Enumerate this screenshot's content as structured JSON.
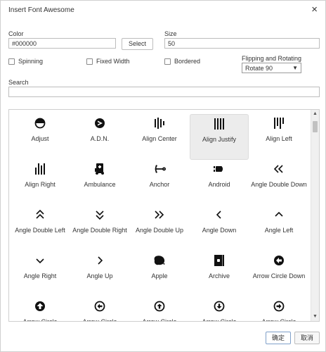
{
  "dialog": {
    "title": "Insert Font Awesome",
    "close_glyph": "×"
  },
  "color": {
    "label": "Color",
    "value": "#000000",
    "select_label": "Select"
  },
  "size": {
    "label": "Size",
    "value": "50"
  },
  "options": {
    "spinning": "Spinning",
    "fixed_width": "Fixed Width",
    "bordered": "Bordered"
  },
  "flipping": {
    "label": "Flipping and Rotating",
    "value": "Rotate 90"
  },
  "search": {
    "label": "Search",
    "value": ""
  },
  "icons": [
    {
      "name": "Adjust",
      "icon": "adjust-icon",
      "selected": false
    },
    {
      "name": "A.D.N.",
      "icon": "adn-icon",
      "selected": false
    },
    {
      "name": "Align Center",
      "icon": "align-center-icon",
      "selected": false
    },
    {
      "name": "Align Justify",
      "icon": "align-justify-icon",
      "selected": true
    },
    {
      "name": "Align Left",
      "icon": "align-left-icon",
      "selected": false
    },
    {
      "name": "Align Right",
      "icon": "align-right-icon",
      "selected": false
    },
    {
      "name": "Ambulance",
      "icon": "ambulance-icon",
      "selected": false
    },
    {
      "name": "Anchor",
      "icon": "anchor-icon",
      "selected": false
    },
    {
      "name": "Android",
      "icon": "android-icon",
      "selected": false
    },
    {
      "name": "Angle Double Down",
      "icon": "angle-double-down-icon",
      "selected": false
    },
    {
      "name": "Angle Double Left",
      "icon": "angle-double-left-icon",
      "selected": false
    },
    {
      "name": "Angle Double Right",
      "icon": "angle-double-right-icon",
      "selected": false
    },
    {
      "name": "Angle Double Up",
      "icon": "angle-double-up-icon",
      "selected": false
    },
    {
      "name": "Angle Down",
      "icon": "angle-down-icon",
      "selected": false
    },
    {
      "name": "Angle Left",
      "icon": "angle-left-icon",
      "selected": false
    },
    {
      "name": "Angle Right",
      "icon": "angle-right-icon",
      "selected": false
    },
    {
      "name": "Angle Up",
      "icon": "angle-up-icon",
      "selected": false
    },
    {
      "name": "Apple",
      "icon": "apple-icon",
      "selected": false
    },
    {
      "name": "Archive",
      "icon": "archive-icon",
      "selected": false
    },
    {
      "name": "Arrow Circle Down",
      "icon": "arrow-circle-down-icon",
      "selected": false
    },
    {
      "name": "Arrow Circle",
      "icon": "arrow-circle-up-icon",
      "selected": false
    },
    {
      "name": "Arrow Circle",
      "icon": "arrow-circle-left-icon",
      "selected": false
    },
    {
      "name": "Arrow Circle",
      "icon": "arrow-circle-up-icon",
      "selected": false
    },
    {
      "name": "Arrow Circle",
      "icon": "arrow-circle-down-icon",
      "selected": false
    },
    {
      "name": "Arrow Circle",
      "icon": "arrow-circle-right-icon",
      "selected": false
    }
  ],
  "footer": {
    "ok_label": "确定",
    "cancel_label": "取消"
  },
  "colors": {
    "selected_bg": "#ececec",
    "border": "#bdbdbd",
    "icon": "#111111"
  }
}
